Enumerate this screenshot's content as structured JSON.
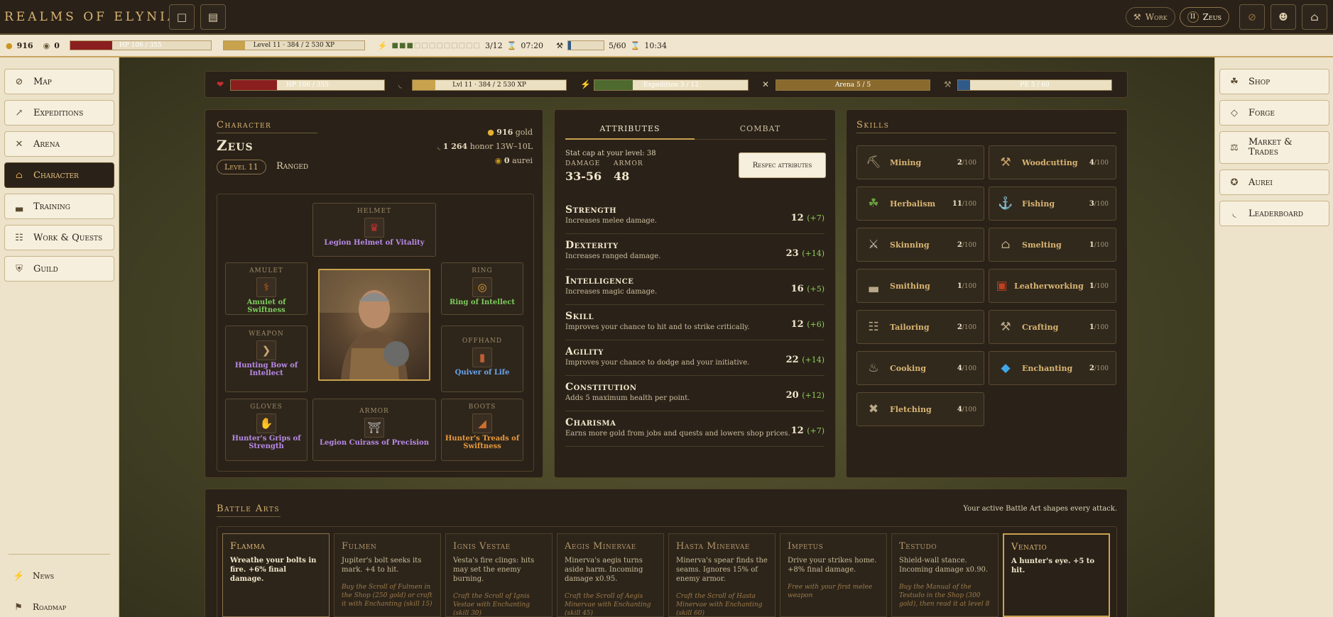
{
  "app": {
    "title": "Realms of Elynia"
  },
  "topbar": {
    "work_label": "Work",
    "user_label": "Zeus",
    "user_badge": "II"
  },
  "status": {
    "gold": "916",
    "aurei": "0",
    "hp_text": "HP 106 / 355",
    "hp_fraction": 0.3,
    "level_text": "Level 11 · 384 / 2 530 XP",
    "xp_fraction": 0.15,
    "expedition_count": "3/12",
    "expedition_timer": "07:20",
    "work_count": "5/60",
    "work_timer": "10:34",
    "work_fraction": 0.08
  },
  "nav_left": [
    {
      "label": "Map",
      "icon": "compass-icon"
    },
    {
      "label": "Expeditions",
      "icon": "spear-icon"
    },
    {
      "label": "Arena",
      "icon": "crossed-swords-icon"
    },
    {
      "label": "Character",
      "icon": "house-icon",
      "active": true
    },
    {
      "label": "Training",
      "icon": "anvil-icon"
    },
    {
      "label": "Work & Quests",
      "icon": "scroll-icon"
    },
    {
      "label": "Guild",
      "icon": "shield-icon"
    }
  ],
  "nav_left_bottom": [
    {
      "label": "News",
      "icon": "lightning-icon"
    },
    {
      "label": "Roadmap",
      "icon": "signpost-icon"
    }
  ],
  "nav_right": [
    {
      "label": "Shop",
      "icon": "pouch-icon"
    },
    {
      "label": "Forge",
      "icon": "gem-icon"
    },
    {
      "label": "Market & Trades",
      "icon": "scales-icon"
    },
    {
      "label": "Aurei",
      "icon": "coin-icon"
    },
    {
      "label": "Leaderboard",
      "icon": "laurel-icon"
    }
  ],
  "summary": {
    "hp": "HP 106 / 355",
    "level": "Lvl 11 · 384 / 2 530 XP",
    "expedition": "Expedition 3 / 12",
    "expedition_fraction": 0.25,
    "arena": "Arena 5 / 5",
    "arena_fraction": 1.0,
    "pe": "PE 5 / 60",
    "pe_fraction": 0.08
  },
  "character": {
    "heading": "Character",
    "name": "Zeus",
    "level_badge": "Level 11",
    "class": "Ranged",
    "gold": "916",
    "gold_label": "gold",
    "honor": "1 264",
    "honor_label": "honor",
    "record": "13W–10L",
    "aurei": "0",
    "aurei_label": "aurei"
  },
  "equipment": {
    "helmet": {
      "label": "Helmet",
      "name": "Legion Helmet of Vitality",
      "rarity": "purple"
    },
    "amulet": {
      "label": "Amulet",
      "name": "Amulet of Swiftness",
      "rarity": "green"
    },
    "ring": {
      "label": "Ring",
      "name": "Ring of Intellect",
      "rarity": "green"
    },
    "weapon": {
      "label": "Weapon",
      "name": "Hunting Bow of Intellect",
      "rarity": "purple"
    },
    "offhand": {
      "label": "Offhand",
      "name": "Quiver of Life",
      "rarity": "blue"
    },
    "gloves": {
      "label": "Gloves",
      "name": "Hunter's Grips of Strength",
      "rarity": "purple"
    },
    "armor": {
      "label": "Armor",
      "name": "Legion Cuirass of Precision",
      "rarity": "purple"
    },
    "boots": {
      "label": "Boots",
      "name": "Hunter's Treads of Swiftness",
      "rarity": "orange"
    }
  },
  "attributes_panel": {
    "tab_attributes": "Attributes",
    "tab_combat": "Combat",
    "stat_cap": "Stat cap at your level: 38",
    "damage_label": "Damage",
    "damage": "33-56",
    "armor_label": "Armor",
    "armor": "48",
    "respec_label": "Respec attributes",
    "list": [
      {
        "name": "Strength",
        "desc": "Increases melee damage.",
        "value": "12",
        "bonus": "(+7)"
      },
      {
        "name": "Dexterity",
        "desc": "Increases ranged damage.",
        "value": "23",
        "bonus": "(+14)"
      },
      {
        "name": "Intelligence",
        "desc": "Increases magic damage.",
        "value": "16",
        "bonus": "(+5)"
      },
      {
        "name": "Skill",
        "desc": "Improves your chance to hit and to strike critically.",
        "value": "12",
        "bonus": "(+6)"
      },
      {
        "name": "Agility",
        "desc": "Improves your chance to dodge and your initiative.",
        "value": "22",
        "bonus": "(+14)"
      },
      {
        "name": "Constitution",
        "desc": "Adds 5 maximum health per point.",
        "value": "20",
        "bonus": "(+12)"
      },
      {
        "name": "Charisma",
        "desc": "Earns more gold from jobs and quests and lowers shop prices.",
        "value": "12",
        "bonus": "(+7)"
      }
    ]
  },
  "skills": {
    "heading": "Skills",
    "list": [
      {
        "name": "Mining",
        "level": "2",
        "max": "/100",
        "icon": "pickaxe-icon"
      },
      {
        "name": "Woodcutting",
        "level": "4",
        "max": "/100",
        "icon": "axe-icon"
      },
      {
        "name": "Herbalism",
        "level": "11",
        "max": "/100",
        "icon": "herb-bowl-icon"
      },
      {
        "name": "Fishing",
        "level": "3",
        "max": "/100",
        "icon": "fishhook-icon"
      },
      {
        "name": "Skinning",
        "level": "2",
        "max": "/100",
        "icon": "knife-icon"
      },
      {
        "name": "Smelting",
        "level": "1",
        "max": "/100",
        "icon": "furnace-icon"
      },
      {
        "name": "Smithing",
        "level": "1",
        "max": "/100",
        "icon": "anvil-icon"
      },
      {
        "name": "Leatherworking",
        "level": "1",
        "max": "/100",
        "icon": "leather-icon"
      },
      {
        "name": "Tailoring",
        "level": "2",
        "max": "/100",
        "icon": "scroll-icon"
      },
      {
        "name": "Crafting",
        "level": "1",
        "max": "/100",
        "icon": "hammer-icon"
      },
      {
        "name": "Cooking",
        "level": "4",
        "max": "/100",
        "icon": "cauldron-icon"
      },
      {
        "name": "Enchanting",
        "level": "2",
        "max": "/100",
        "icon": "diamond-icon"
      },
      {
        "name": "Fletching",
        "level": "4",
        "max": "/100",
        "icon": "arrows-icon"
      }
    ]
  },
  "battle_arts": {
    "heading": "Battle Arts",
    "note": "Your active Battle Art shapes every attack.",
    "list": [
      {
        "name": "Flamma",
        "desc": "Wreathe your bolts in fire. +6% final damage.",
        "hint": "",
        "state": "owned"
      },
      {
        "name": "Fulmen",
        "desc": "Jupiter's bolt seeks its mark. +4 to hit.",
        "hint": "Buy the Scroll of Fulmen in the Shop (250 gold) or craft it with Enchanting (skill 15)",
        "state": "locked"
      },
      {
        "name": "Ignis Vestae",
        "desc": "Vesta's fire clings: hits may set the enemy burning.",
        "hint": "Craft the Scroll of Ignis Vestae with Enchanting (skill 30)",
        "state": "locked"
      },
      {
        "name": "Aegis Minervae",
        "desc": "Minerva's aegis turns aside harm. Incoming damage x0.95.",
        "hint": "Craft the Scroll of Aegis Minervae with Enchanting (skill 45)",
        "state": "locked"
      },
      {
        "name": "Hasta Minervae",
        "desc": "Minerva's spear finds the seams. Ignores 15% of enemy armor.",
        "hint": "Craft the Scroll of Hasta Minervae with Enchanting (skill 60)",
        "state": "locked"
      },
      {
        "name": "Impetus",
        "desc": "Drive your strikes home. +8% final damage.",
        "hint": "Free with your first melee weapon",
        "state": "locked"
      },
      {
        "name": "Testudo",
        "desc": "Shield-wall stance. Incoming damage x0.90.",
        "hint": "Buy the Manual of the Testudo in the Shop (300 gold), then read it at level 8",
        "state": "locked"
      },
      {
        "name": "Venatio",
        "desc": "A hunter's eye. +5 to hit.",
        "hint": "",
        "state": "active"
      }
    ]
  },
  "colors": {
    "accent": "#d9b573",
    "panel": "#2a2118",
    "hp": "#8b1e1e",
    "xp": "#c9a24e",
    "exp": "#4e6a2e",
    "arena": "#8b6a2e",
    "pe": "#2f5a8a"
  }
}
